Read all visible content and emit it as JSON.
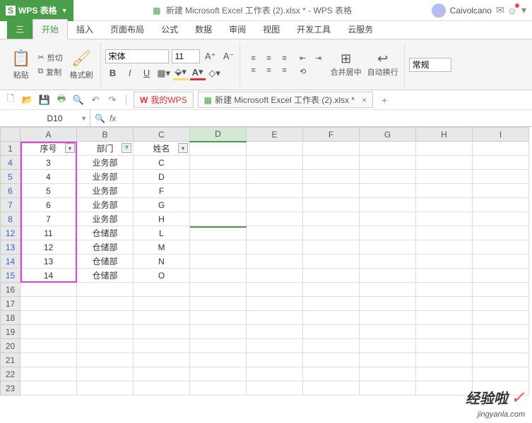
{
  "app": {
    "name": "WPS 表格",
    "badge_s": "S"
  },
  "title": {
    "doc_name": "新建 Microsoft Excel 工作表 (2).xlsx * - WPS 表格",
    "user": "Caivolcano"
  },
  "menu": {
    "file": "三",
    "tabs": [
      "开始",
      "插入",
      "页面布局",
      "公式",
      "数据",
      "审阅",
      "视图",
      "开发工具",
      "云服务"
    ]
  },
  "ribbon": {
    "paste": "粘贴",
    "cut": "剪切",
    "copy": "复制",
    "format_painter": "格式刷",
    "font_name": "宋体",
    "font_size": "11",
    "merge_center": "合并居中",
    "auto_wrap": "自动换行",
    "number_format": "常规"
  },
  "qa": {
    "wps_tab": "我的WPS",
    "doc_tab": "新建 Microsoft Excel 工作表 (2).xlsx *"
  },
  "formula": {
    "name_box": "D10",
    "fx": "fx"
  },
  "sheet": {
    "col_headers": [
      "A",
      "B",
      "C",
      "D",
      "E",
      "F",
      "G",
      "H",
      "I"
    ],
    "active_col": "D",
    "header_row": {
      "num": "1",
      "cells": [
        "序号",
        "部门",
        "姓名"
      ]
    },
    "rows": [
      {
        "num": "4",
        "cells": [
          "3",
          "业务部",
          "C"
        ]
      },
      {
        "num": "5",
        "cells": [
          "4",
          "业务部",
          "D"
        ]
      },
      {
        "num": "6",
        "cells": [
          "5",
          "业务部",
          "F"
        ]
      },
      {
        "num": "7",
        "cells": [
          "6",
          "业务部",
          "G"
        ]
      },
      {
        "num": "8",
        "cells": [
          "7",
          "业务部",
          "H"
        ]
      },
      {
        "num": "12",
        "cells": [
          "11",
          "仓储部",
          "L"
        ]
      },
      {
        "num": "13",
        "cells": [
          "12",
          "仓储部",
          "M"
        ]
      },
      {
        "num": "14",
        "cells": [
          "13",
          "仓储部",
          "N"
        ]
      },
      {
        "num": "15",
        "cells": [
          "14",
          "仓储部",
          "O"
        ]
      }
    ],
    "empty_rows": [
      "16",
      "17",
      "18",
      "19",
      "20",
      "21",
      "22",
      "23"
    ]
  },
  "watermark": {
    "main": "经验啦",
    "sub": "jingyanla.com"
  }
}
